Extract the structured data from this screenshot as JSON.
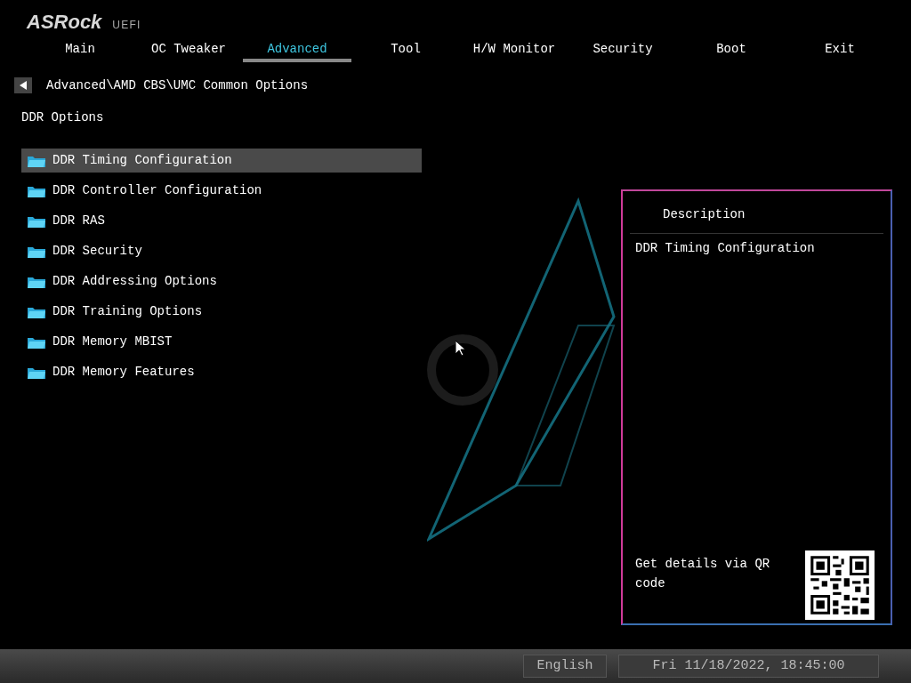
{
  "logo": {
    "brand": "ASRock",
    "suffix": "UEFI"
  },
  "tabs": [
    {
      "label": "Main",
      "selected": false
    },
    {
      "label": "OC Tweaker",
      "selected": false
    },
    {
      "label": "Advanced",
      "selected": true
    },
    {
      "label": "Tool",
      "selected": false
    },
    {
      "label": "H/W Monitor",
      "selected": false
    },
    {
      "label": "Security",
      "selected": false
    },
    {
      "label": "Boot",
      "selected": false
    },
    {
      "label": "Exit",
      "selected": false
    }
  ],
  "breadcrumb": {
    "path": "Advanced\\AMD CBS\\UMC Common Options"
  },
  "section_title": "DDR Options",
  "menu_items": [
    {
      "label": "DDR Timing Configuration",
      "selected": true
    },
    {
      "label": "DDR Controller Configuration",
      "selected": false
    },
    {
      "label": "DDR RAS",
      "selected": false
    },
    {
      "label": "DDR Security",
      "selected": false
    },
    {
      "label": "DDR Addressing Options",
      "selected": false
    },
    {
      "label": "DDR Training Options",
      "selected": false
    },
    {
      "label": "DDR Memory MBIST",
      "selected": false
    },
    {
      "label": "DDR Memory Features",
      "selected": false
    }
  ],
  "description": {
    "title": "Description",
    "text": "DDR Timing Configuration",
    "qr_hint": "Get details via QR code"
  },
  "status_bar": {
    "language": "English",
    "datetime": "Fri 11/18/2022, 18:45:00"
  }
}
